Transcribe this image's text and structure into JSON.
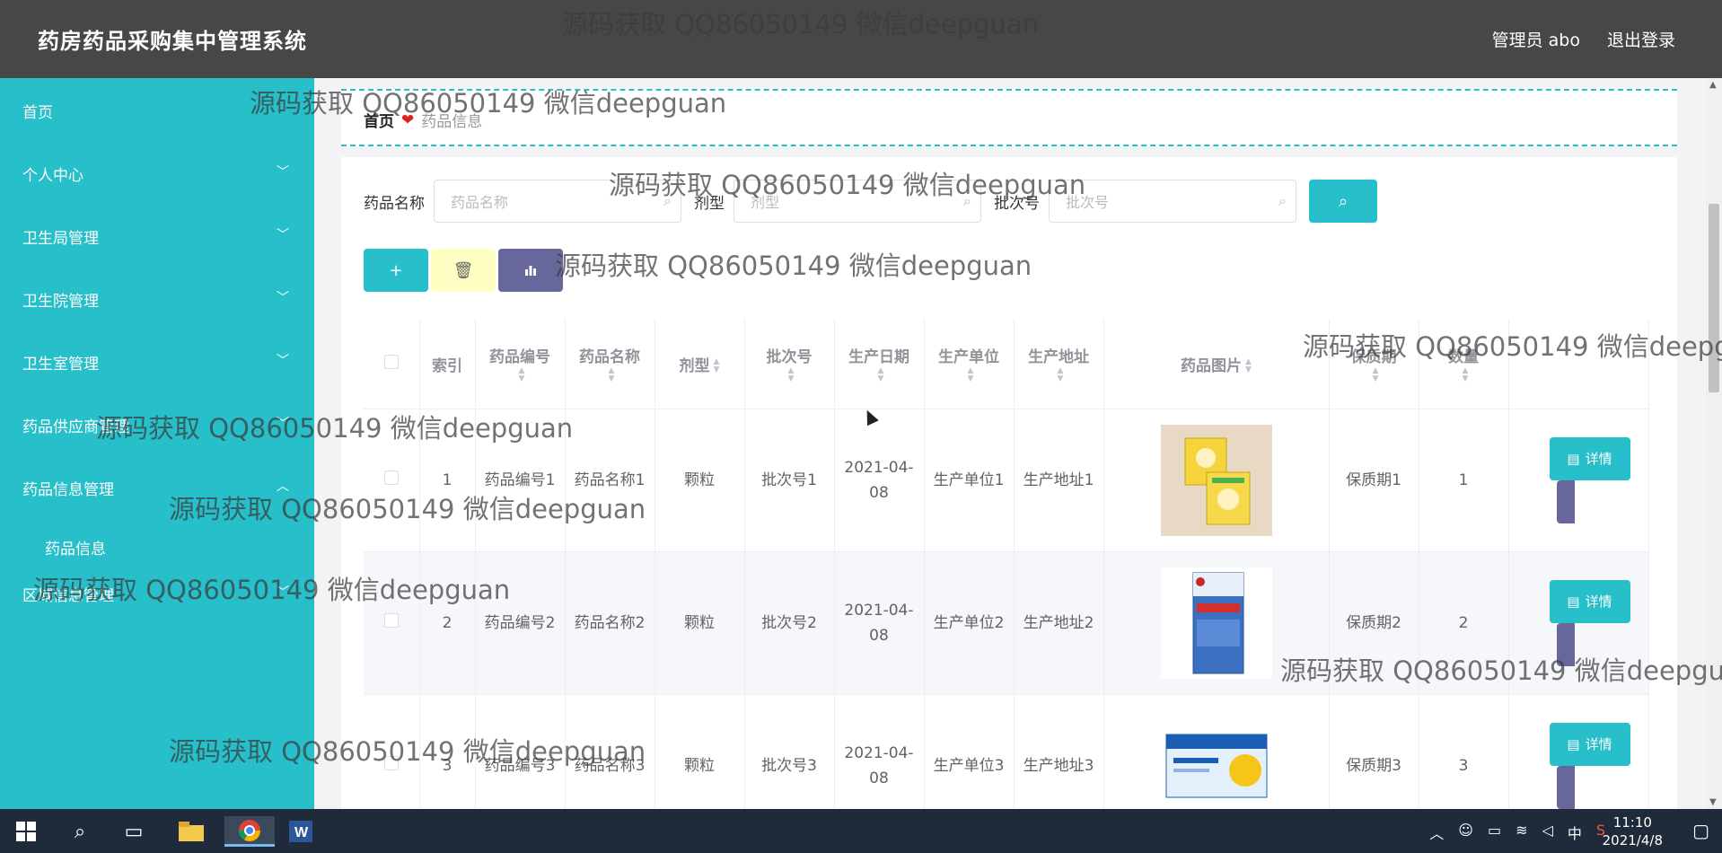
{
  "header": {
    "title": "药房药品采购集中管理系统",
    "user": "管理员 abo",
    "logout": "退出登录"
  },
  "sidebar": {
    "items": [
      {
        "label": "首页",
        "has_children": false
      },
      {
        "label": "个人中心",
        "has_children": true
      },
      {
        "label": "卫生局管理",
        "has_children": true
      },
      {
        "label": "卫生院管理",
        "has_children": true
      },
      {
        "label": "卫生室管理",
        "has_children": true
      },
      {
        "label": "药品供应商管理",
        "has_children": true
      },
      {
        "label": "药品信息管理",
        "has_children": true,
        "expanded": true
      },
      {
        "label": "区域信息管理",
        "has_children": true
      }
    ],
    "sub_item": "药品信息"
  },
  "breadcrumb": {
    "home": "首页",
    "separator": "❤",
    "current": "药品信息"
  },
  "search": {
    "name_label": "药品名称",
    "name_placeholder": "药品名称",
    "type_label": "剂型",
    "type_placeholder": "剂型",
    "batch_label": "批次号",
    "batch_placeholder": "批次号"
  },
  "table": {
    "headers": [
      "索引",
      "药品编号",
      "药品名称",
      "剂型",
      "批次号",
      "生产日期",
      "生产单位",
      "生产地址",
      "药品图片",
      "保质期",
      "数量"
    ],
    "rows": [
      {
        "index": "1",
        "code": "药品编号1",
        "name": "药品名称1",
        "form": "颗粒",
        "batch": "批次号1",
        "date": "2021-04-08",
        "maker": "生产单位1",
        "addr": "生产地址1",
        "shelf": "保质期1",
        "qty": "1"
      },
      {
        "index": "2",
        "code": "药品编号2",
        "name": "药品名称2",
        "form": "颗粒",
        "batch": "批次号2",
        "date": "2021-04-08",
        "maker": "生产单位2",
        "addr": "生产地址2",
        "shelf": "保质期2",
        "qty": "2"
      },
      {
        "index": "3",
        "code": "药品编号3",
        "name": "药品名称3",
        "form": "颗粒",
        "batch": "批次号3",
        "date": "2021-04-08",
        "maker": "生产单位3",
        "addr": "生产地址3",
        "shelf": "保质期3",
        "qty": "3"
      }
    ],
    "detail_label": "详情"
  },
  "watermark": "源码获取 QQ86050149 微信deepguan",
  "taskbar": {
    "time": "11:10",
    "date": "2021/4/8",
    "ime": "中"
  },
  "colors": {
    "accent": "#27bfc9",
    "header": "#474747",
    "chart_button": "#67679c",
    "delete_button": "#ffffc4"
  }
}
